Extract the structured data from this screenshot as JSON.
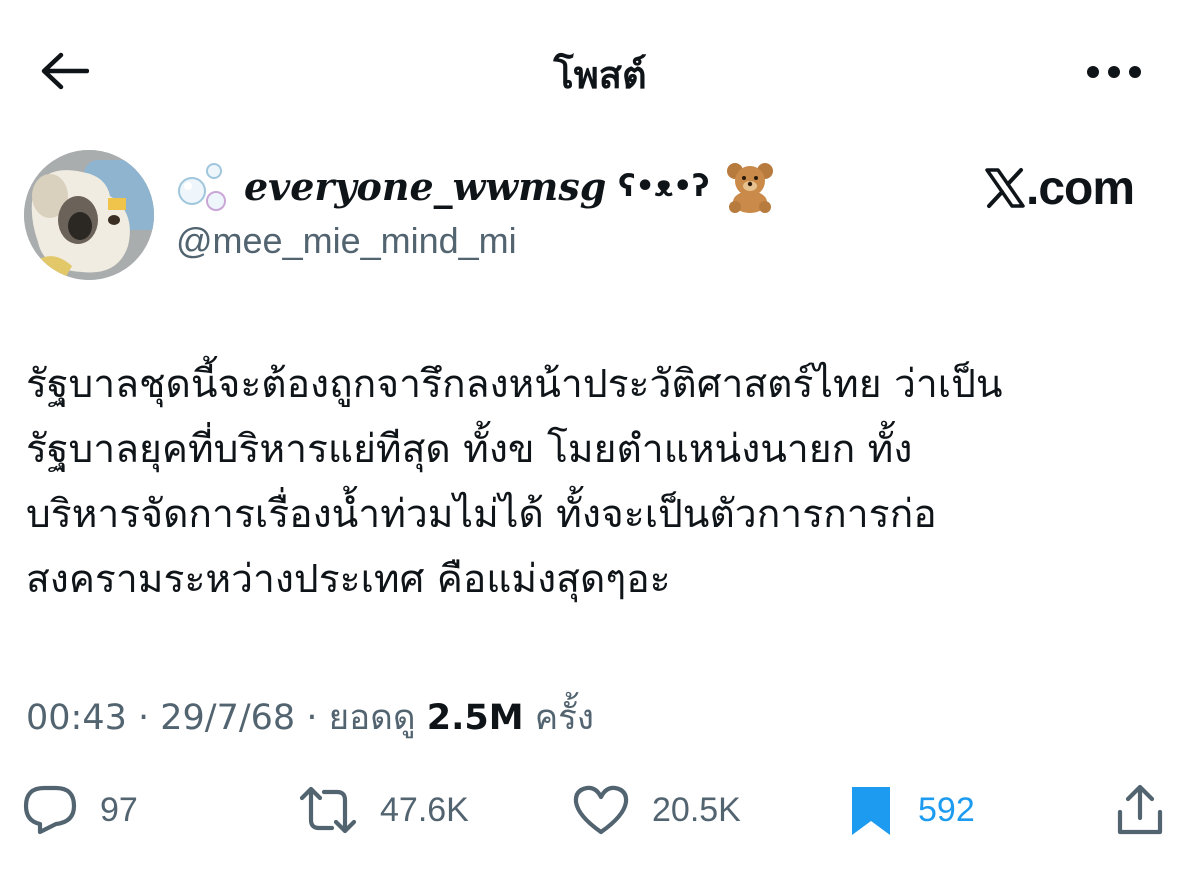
{
  "header": {
    "title": "โพสต์"
  },
  "user": {
    "display_name": "everyone_wwmsg",
    "kaomoji": "ʕ•ᴥ•ʔ",
    "handle": "@mee_mie_mind_mi"
  },
  "watermark": {
    "text": ".com"
  },
  "tweet": {
    "text": "รัฐบาลชุดนี้จะต้องถูกจารึกลงหน้าประวัติศาสตร์ไทย ว่าเป็น\nรัฐบาลยุคที่บริหารแย่ทีสุด ทั้งข โมยตำแหน่งนายก ทั้ง\nบริหารจัดการเรื่องน้ำท่วมไม่ได้ ทั้งจะเป็นตัวการการก่อ\nสงครามระหว่างประเทศ คือแม่งสุดๆอะ"
  },
  "meta": {
    "time": "00:43",
    "sep1": " · ",
    "date": "29/7/68",
    "sep2": " · ",
    "views_label": "ยอดดู",
    "views_count": "2.5M",
    "views_suffix": "ครั้ง"
  },
  "actions": {
    "replies": "97",
    "reposts": "47.6K",
    "likes": "20.5K",
    "bookmarks": "592"
  },
  "colors": {
    "text": "#0f1419",
    "muted": "#536471",
    "accent": "#1d9bf0"
  },
  "icons": {
    "back": "arrow-left-icon",
    "more": "more-horizontal-icon",
    "reply": "reply-icon",
    "repost": "repost-icon",
    "like": "heart-icon",
    "bookmark": "bookmark-icon",
    "share": "share-icon"
  }
}
